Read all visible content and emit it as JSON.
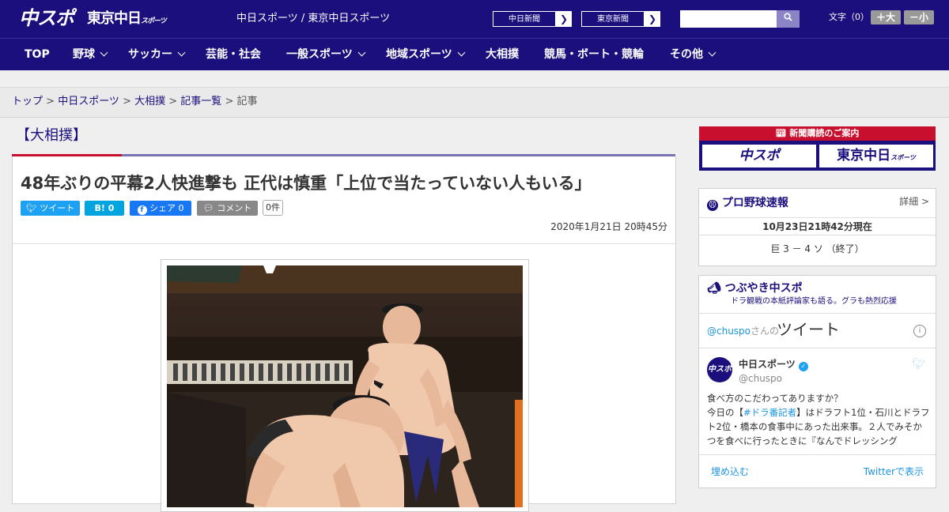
{
  "header": {
    "logo_main": "中スポ",
    "logo_tokyo": "東京中日",
    "logo_tokyo_small": "スポーツ",
    "site_title": "中日スポーツ / 東京中日スポーツ",
    "link1": "中日新聞",
    "link2": "東京新聞",
    "search_button": "Q",
    "font_label": "文字（0）",
    "font_bigger": "＋大",
    "font_smaller": "－小"
  },
  "nav": {
    "items": [
      "TOP",
      "野球",
      "サッカー",
      "芸能・社会",
      "一般スポーツ",
      "地域スポーツ",
      "大相撲",
      "競馬・ボート・競輪",
      "その他"
    ]
  },
  "breadcrumb": {
    "top": "トップ",
    "chuspo": "中日スポーツ",
    "sumo": "大相撲",
    "list": "記事一覧",
    "current": "記事",
    "sep": " > "
  },
  "article": {
    "category": "【大相撲】",
    "headline": "48年ぶりの平幕2人快進撃も 正代は慎重「上位で当たっていない人もいる」",
    "tweet": "ツイート",
    "hatena": "B! 0",
    "share": "シェア 0",
    "comment": "コメント",
    "comment_count": "0件",
    "date": "2020年1月21日 20時45分"
  },
  "promo": {
    "title": "新聞購読のご案内",
    "btn1": "中スポ",
    "btn2": "東京中日",
    "btn2_small": "スポーツ"
  },
  "baseball": {
    "title": "プロ野球速報",
    "more": "詳細 >",
    "time": "10月23日21時42分現在",
    "score": "巨 3 － 4 ソ （終了）"
  },
  "twitter": {
    "title": "つぶやき中スポ",
    "subtitle": "ドラ観戦の本紙評論家も語る。グラも熱烈応援",
    "handle": "@chuspo",
    "handle_suffix": "さんの",
    "label": "ツイート",
    "info": "i",
    "avatar_text": "中スポ",
    "name": "中日スポーツ",
    "at": "@chuspo",
    "body_line1": "食べ方のこだわってありますか？",
    "body_line2_pre": "今日の【",
    "body_tag": "#ドラ番記者",
    "body_line2_post": "】はドラフト1位・石川とドラフト2位・橋本の食事中にあった出来事。２人でみそかつを食べに行ったときに『なんでドレッシング",
    "embed": "埋め込む",
    "view": "Twitterで表示"
  },
  "colors": {
    "brand": "#1a0f7c",
    "accent": "#c8102e",
    "twitter": "#1da1f2",
    "facebook": "#1877f2",
    "hatena": "#00a4de"
  }
}
